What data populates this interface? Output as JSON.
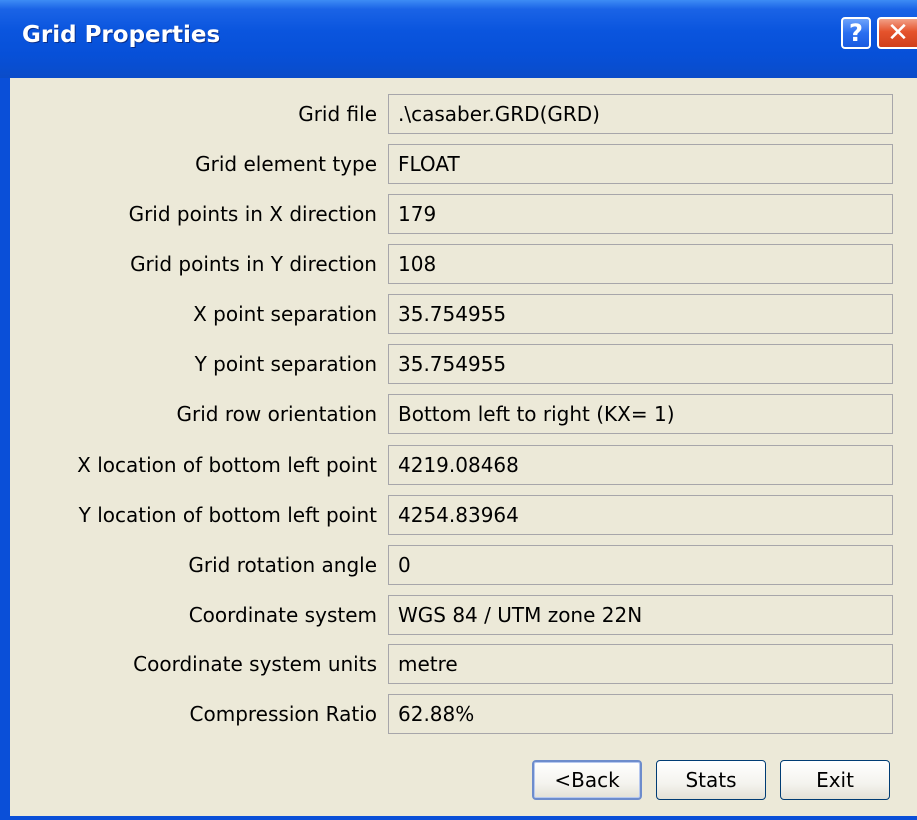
{
  "window": {
    "title": "Grid Properties",
    "help_glyph": "?",
    "close_glyph": "✕",
    "colors": {
      "titlebar": "#0750d8",
      "client_bg": "#ece9d8",
      "close_button": "#e5532c"
    }
  },
  "properties": [
    {
      "label": "Grid file",
      "value": ".\\casaber.GRD(GRD)"
    },
    {
      "label": "Grid element type",
      "value": "FLOAT"
    },
    {
      "label": "Grid points in X direction",
      "value": "179"
    },
    {
      "label": "Grid points in Y direction",
      "value": "108"
    },
    {
      "label": "X point separation",
      "value": "35.754955"
    },
    {
      "label": "Y point separation",
      "value": "35.754955"
    },
    {
      "label": "Grid row orientation",
      "value": "Bottom left to right (KX= 1)"
    },
    {
      "label": "X location of bottom left point",
      "value": "4219.08468"
    },
    {
      "label": "Y location of bottom left point",
      "value": "4254.83964"
    },
    {
      "label": "Grid rotation angle",
      "value": "0"
    },
    {
      "label": "Coordinate system",
      "value": "WGS 84 / UTM zone 22N"
    },
    {
      "label": "Coordinate system units",
      "value": "metre"
    },
    {
      "label": "Compression Ratio",
      "value": "62.88%"
    }
  ],
  "buttons": {
    "back": "<Back",
    "stats": "Stats",
    "exit": "Exit"
  }
}
